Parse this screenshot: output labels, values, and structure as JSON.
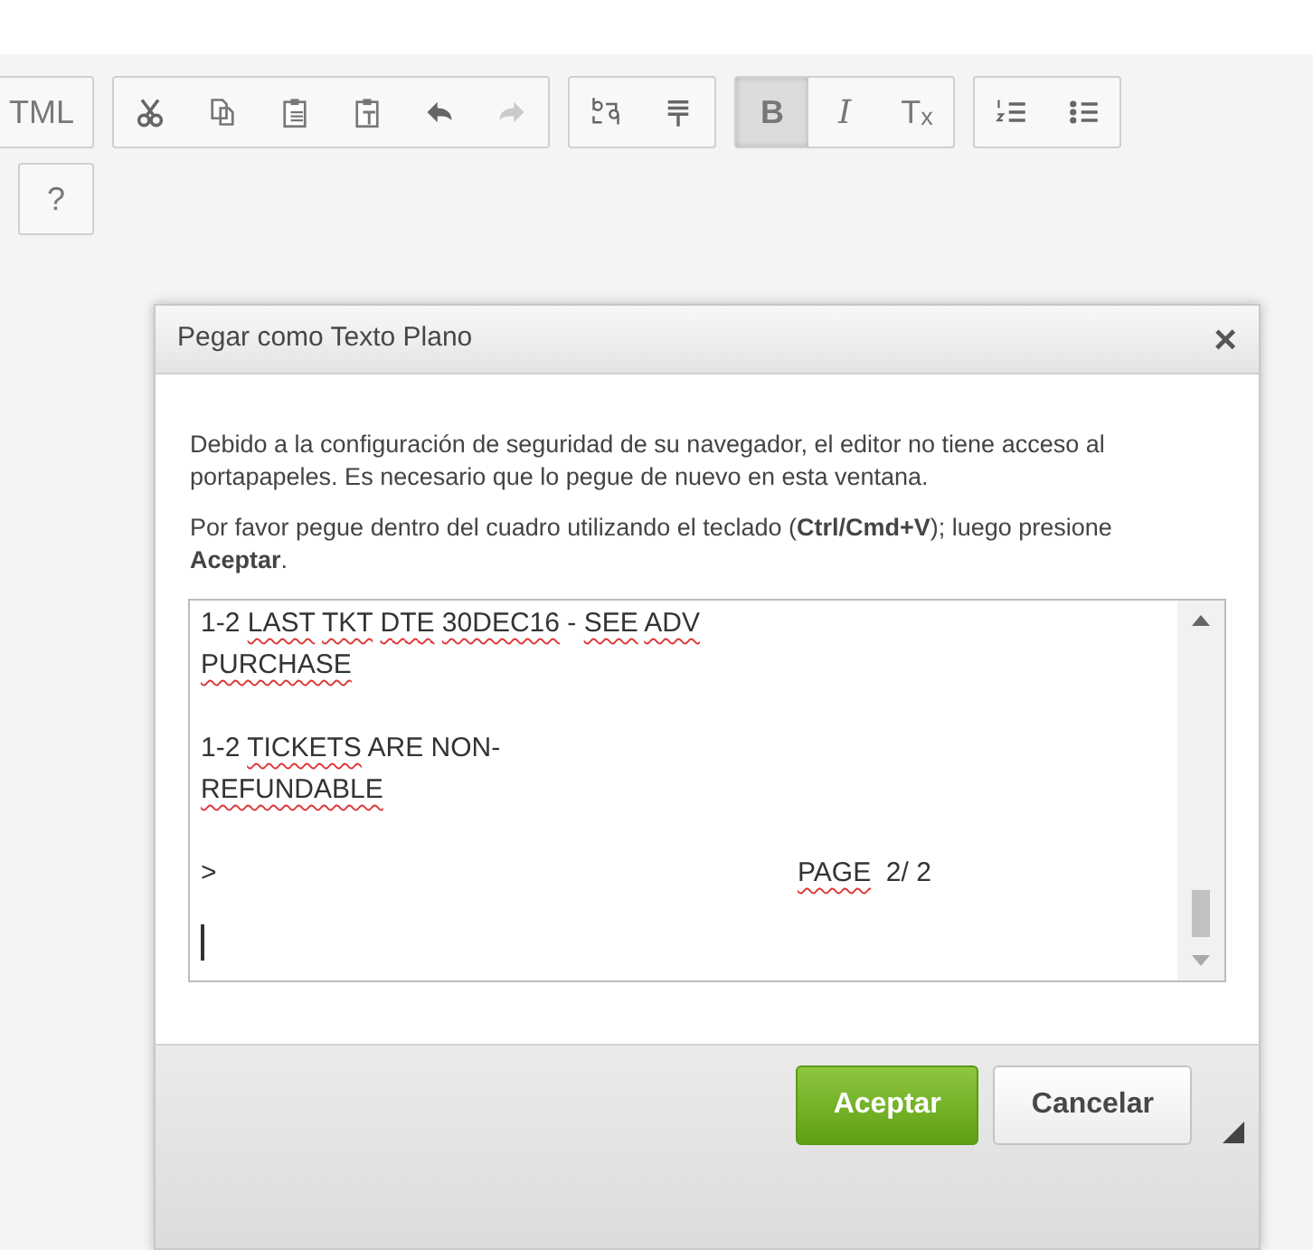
{
  "toolbar": {
    "rows": [
      {
        "groups": [
          {
            "buttons": [
              {
                "kind": "text",
                "text": "TML",
                "selected": false,
                "disabled": false
              }
            ]
          },
          {
            "buttons": [
              {
                "kind": "cut",
                "selected": false,
                "disabled": false
              },
              {
                "kind": "copy",
                "selected": false,
                "disabled": false
              },
              {
                "kind": "paste",
                "selected": false,
                "disabled": false
              },
              {
                "kind": "paste-text",
                "selected": false,
                "disabled": false
              },
              {
                "kind": "undo",
                "selected": false,
                "disabled": false
              },
              {
                "kind": "redo",
                "selected": false,
                "disabled": true
              }
            ]
          },
          {
            "buttons": [
              {
                "kind": "replace",
                "selected": false,
                "disabled": false
              },
              {
                "kind": "lines",
                "selected": false,
                "disabled": false
              }
            ]
          },
          {
            "buttons": [
              {
                "kind": "text",
                "text": "B",
                "selected": true,
                "disabled": false
              },
              {
                "kind": "text",
                "text": "I",
                "selected": false,
                "disabled": false
              },
              {
                "kind": "text",
                "text": "T$_{x}$",
                "selected": false,
                "disabled": false
              }
            ]
          },
          {
            "buttons": [
              {
                "kind": "numbered-list",
                "selected": false,
                "disabled": false
              },
              {
                "kind": "bullet-list",
                "selected": false,
                "disabled": false
              }
            ]
          }
        ]
      },
      {
        "groups": [
          {
            "buttons": [
              {
                "kind": "text",
                "text": "?",
                "selected": false,
                "disabled": false
              }
            ]
          }
        ]
      }
    ]
  },
  "dialog": {
    "title": "Pegar como Texto Plano",
    "close": "×",
    "paragraphs": [
      "Debido a la configuración de seguridad de su navegador, el editor no tiene acceso al portapapeles. Es necesario que lo pegue de nuevo en esta ventana.",
      "Por favor pegue dentro del cuadro utilizando el teclado (**Ctrl/Cmd+V**); luego presione **Aceptar**."
    ],
    "text_area": {
      "lines": [
        {
          "cells": [
            [
              {
                "text": "1-2",
                "misspelled": false
              },
              {
                "text": " LAST",
                "misspelled": true
              },
              {
                "text": " TKT",
                "misspelled": true
              },
              {
                "text": " DTE",
                "misspelled": true
              },
              {
                "text": " 30DEC16",
                "misspelled": true
              },
              {
                "text": " -",
                "misspelled": false
              },
              {
                "text": " SEE",
                "misspelled": true
              },
              {
                "text": " ADV",
                "misspelled": true
              }
            ]
          ],
          "gap_after": false
        },
        {
          "cells": [
            [
              {
                "text": "PURCHASE",
                "misspelled": true
              }
            ]
          ],
          "gap_after": true
        },
        {
          "cells": [
            [
              {
                "text": "1-2",
                "misspelled": false
              },
              {
                "text": " TICKETS",
                "misspelled": true
              },
              {
                "text": " ARE NON-",
                "misspelled": false
              }
            ]
          ],
          "gap_after": false
        },
        {
          "cells": [
            [
              {
                "text": "REFUNDABLE",
                "misspelled": true
              }
            ]
          ],
          "gap_after": true
        },
        {
          "cells": [
            [
              {
                "text": ">",
                "misspelled": false
              }
            ],
            [
              {
                "text": "PAGE",
                "misspelled": true
              },
              {
                "text": "  2/ 2",
                "misspelled": false
              }
            ]
          ],
          "gap_after": true
        }
      ]
    },
    "buttons": [
      {
        "label": "Aceptar",
        "kind": "primary"
      },
      {
        "label": "Cancelar",
        "kind": "secondary"
      }
    ]
  }
}
